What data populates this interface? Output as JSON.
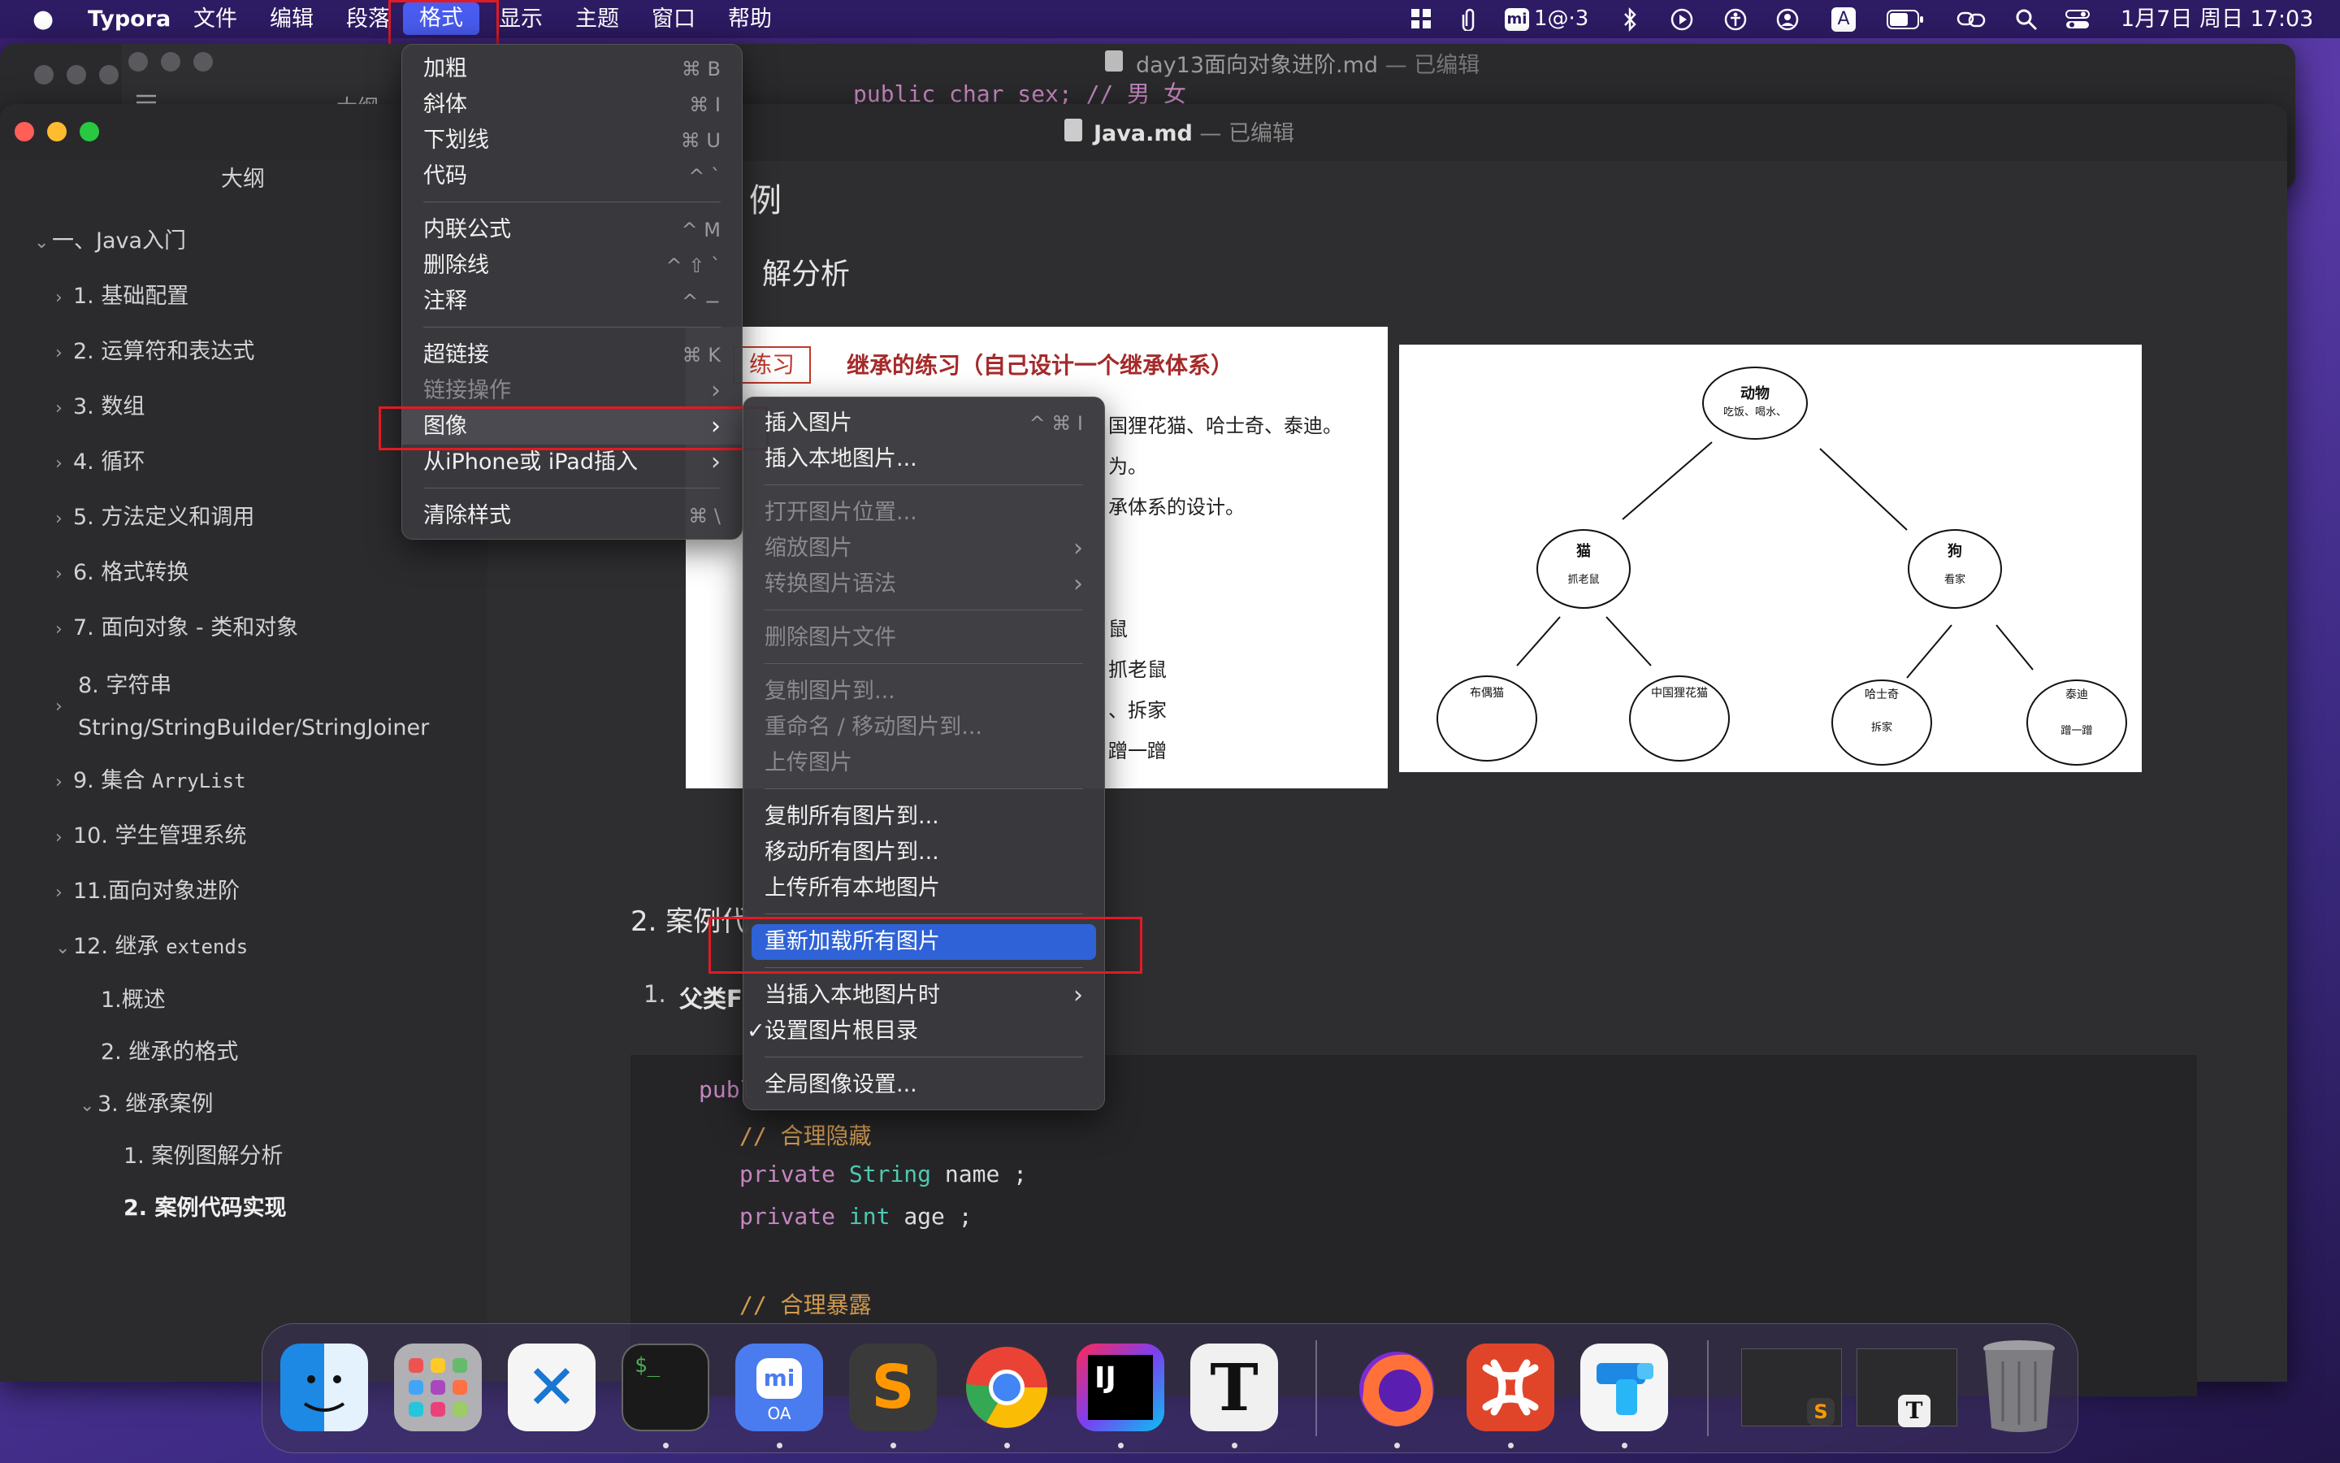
{
  "menubar": {
    "app": "Typora",
    "items": [
      "文件",
      "编辑",
      "段落",
      "格式",
      "显示",
      "主题",
      "窗口",
      "帮助"
    ],
    "status_text": "1@·3",
    "status_letter": "A",
    "datetime": "1月7日 周日 17:03"
  },
  "back_window": {
    "title": "day13面向对象进阶.md",
    "suffix": "— 已编辑",
    "code_peek": "public char sex; // 男  女",
    "sidebar_header": "大纲"
  },
  "front_window": {
    "title": "Java.md",
    "suffix": "— 已编辑"
  },
  "outline": {
    "header": "大纲",
    "items": [
      {
        "label": "一、Java入门",
        "chev": "⌄"
      },
      {
        "label": "1. 基础配置",
        "chev": "›"
      },
      {
        "label": "2. 运算符和表达式",
        "chev": "›"
      },
      {
        "label": "3. 数组",
        "chev": "›"
      },
      {
        "label": "4. 循环",
        "chev": "›"
      },
      {
        "label": "5. 方法定义和调用",
        "chev": "›"
      },
      {
        "label": "6. 格式转换",
        "chev": "›"
      },
      {
        "label": "7. 面向对象 - 类和对象",
        "chev": "›"
      },
      {
        "label": "8. 字符串",
        "label2": "String/StringBuilder/StringJoiner",
        "chev": "›"
      },
      {
        "label": "9. 集合 ",
        "mono": "ArryList",
        "chev": "›"
      },
      {
        "label": "10. 学生管理系统",
        "chev": "›"
      },
      {
        "label": "11.面向对象进阶",
        "chev": "›"
      },
      {
        "label": "12. 继承 ",
        "mono": "extends",
        "chev": "⌄"
      },
      {
        "label": "1.概述",
        "chev": ""
      },
      {
        "label": "2. 继承的格式",
        "chev": ""
      },
      {
        "label": "3. 继承案例",
        "chev": "⌄"
      },
      {
        "label": "1. 案例图解分析",
        "chev": ""
      },
      {
        "label": "2. 案例代码实现",
        "chev": ""
      }
    ]
  },
  "content": {
    "heading_partial": "例",
    "subheading_partial": "解分析",
    "exercise": {
      "tag": "练习",
      "title": "继承的练习（自己设计一个继承体系）",
      "lines": [
        "国狸花猫、哈士奇、泰迪。",
        "为。",
        "承体系的设计。",
        "鼠",
        "抓老鼠",
        "、拆家",
        "蹭一蹭"
      ]
    },
    "tree": {
      "root": {
        "name": "动物",
        "desc": "吃饭、喝水、"
      },
      "cat": {
        "name": "猫",
        "desc": "抓老鼠"
      },
      "dog": {
        "name": "狗",
        "desc": "看家"
      },
      "leaves": [
        {
          "name": "布偶猫",
          "desc": ""
        },
        {
          "name": "中国狸花猫",
          "desc": ""
        },
        {
          "name": "哈士奇",
          "desc": "拆家"
        },
        {
          "name": "泰迪",
          "desc": "蹭一蹭"
        }
      ]
    },
    "section2_partial": "2. 案例代",
    "list_prefix": "1.",
    "list_partial": "父类F",
    "code": {
      "line0": "publ",
      "comment1": "// 合理隐藏",
      "kw1": "private",
      "type1": "String",
      "rest1": "name ;",
      "kw2": "private",
      "type2": "int",
      "rest2": "age ;",
      "comment2": "// 合理暴露"
    }
  },
  "format_menu": {
    "items": [
      {
        "label": "加粗",
        "sc": "⌘ B"
      },
      {
        "label": "斜体",
        "sc": "⌘ I"
      },
      {
        "label": "下划线",
        "sc": "⌘ U"
      },
      {
        "label": "代码",
        "sc": "^ `"
      },
      {
        "label": "内联公式",
        "sc": "^ M"
      },
      {
        "label": "删除线",
        "sc": "^ ⇧ `"
      },
      {
        "label": "注释",
        "sc": "^ −"
      },
      {
        "label": "超链接",
        "sc": "⌘ K"
      },
      {
        "label": "链接操作",
        "sc": "›"
      },
      {
        "label": "图像",
        "sc": "›"
      },
      {
        "label": "从iPhone或 iPad插入",
        "sc": "›"
      },
      {
        "label": "清除样式",
        "sc": "⌘ \\"
      }
    ]
  },
  "image_menu": {
    "items": [
      {
        "label": "插入图片",
        "sc": "^ ⌘ I"
      },
      {
        "label": "插入本地图片...",
        "sc": ""
      },
      {
        "label": "打开图片位置...",
        "sc": ""
      },
      {
        "label": "缩放图片",
        "sc": "›"
      },
      {
        "label": "转换图片语法",
        "sc": "›"
      },
      {
        "label": "删除图片文件",
        "sc": ""
      },
      {
        "label": "复制图片到...",
        "sc": ""
      },
      {
        "label": "重命名 / 移动图片到...",
        "sc": ""
      },
      {
        "label": "上传图片",
        "sc": ""
      },
      {
        "label": "复制所有图片到...",
        "sc": ""
      },
      {
        "label": "移动所有图片到...",
        "sc": ""
      },
      {
        "label": "上传所有本地图片",
        "sc": ""
      },
      {
        "label": "重新加载所有图片",
        "sc": ""
      },
      {
        "label": "当插入本地图片时",
        "sc": "›"
      },
      {
        "label": "设置图片根目录",
        "sc": "",
        "check": "✓"
      },
      {
        "label": "全局图像设置...",
        "sc": ""
      }
    ]
  },
  "dock": {
    "vscode_glyph": "✕",
    "terminal_text": "$_",
    "mi_text": "mi",
    "mi_sub": "OA",
    "sublime_glyph": "S",
    "ij_text": "IJ",
    "typora_glyph": "T"
  },
  "colors": {
    "accent": "#2f62d6",
    "menubar": "#2d1b63",
    "redbox": "#e01b24"
  }
}
